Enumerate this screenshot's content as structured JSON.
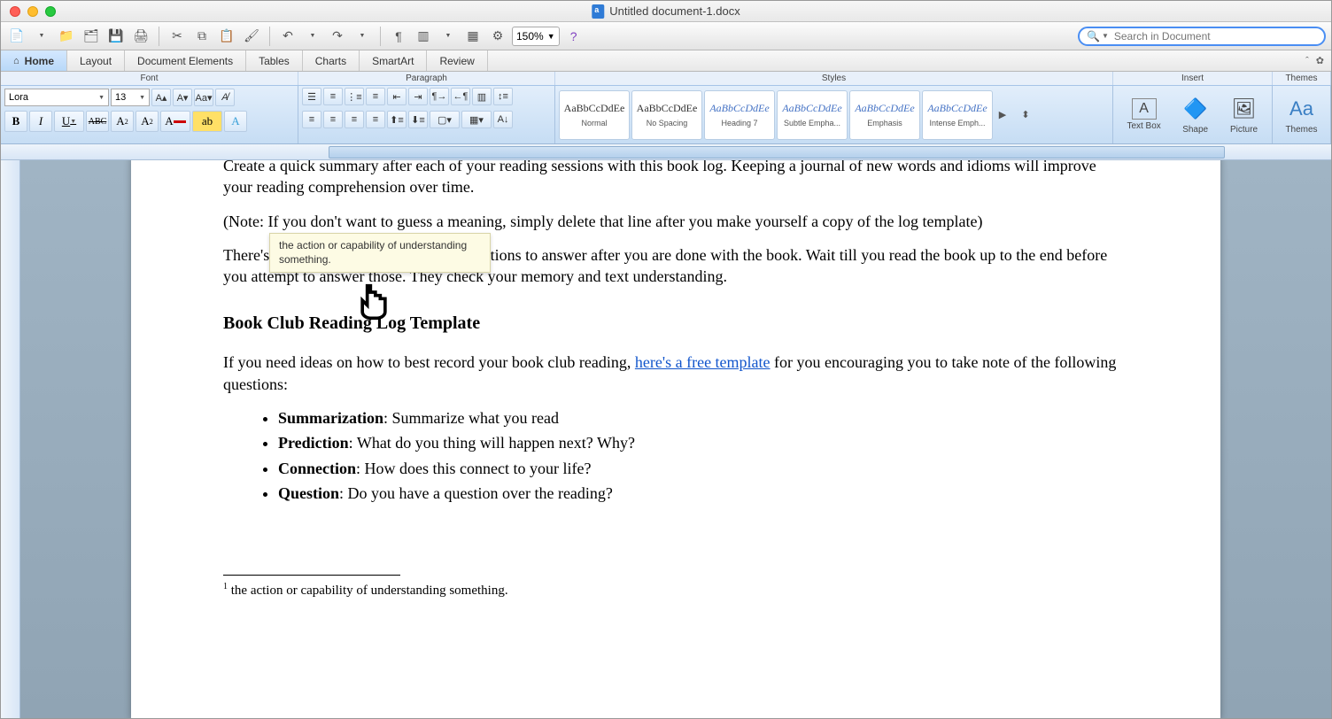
{
  "window": {
    "title": "Untitled document-1.docx"
  },
  "toolbar": {
    "zoom": "150%",
    "search_placeholder": "Search in Document"
  },
  "tabs": {
    "home": "Home",
    "layout": "Layout",
    "docel": "Document Elements",
    "tables": "Tables",
    "charts": "Charts",
    "smartart": "SmartArt",
    "review": "Review"
  },
  "groupLabels": {
    "font": "Font",
    "para": "Paragraph",
    "styles": "Styles",
    "insert": "Insert",
    "themes": "Themes"
  },
  "font": {
    "name": "Lora",
    "size": "13",
    "bold": "B",
    "italic": "I",
    "under": "U",
    "strike": "ABC",
    "sup": "A²",
    "sub": "A₂"
  },
  "styles": {
    "s1": {
      "sample": "AaBbCcDdEe",
      "name": "Normal"
    },
    "s2": {
      "sample": "AaBbCcDdEe",
      "name": "No Spacing"
    },
    "s3": {
      "sample": "AaBbCcDdEe",
      "name": "Heading 7"
    },
    "s4": {
      "sample": "AaBbCcDdEe",
      "name": "Subtle Empha..."
    },
    "s5": {
      "sample": "AaBbCcDdEe",
      "name": "Emphasis"
    },
    "s6": {
      "sample": "AaBbCcDdEe",
      "name": "Intense Emph..."
    }
  },
  "insert": {
    "textbox": "Text Box",
    "shape": "Shape",
    "picture": "Picture",
    "themes": "Themes"
  },
  "doc": {
    "p1": "Create a quick summary after each of your reading sessions with this book log. Keeping a journal of new words and idioms will improve your reading comprehension over time.",
    "p2": "(Note: If you don't want to guess a meaning, simply delete that line after you make yourself a copy of the log template)",
    "p3a": "There's also a list of comprehension",
    "p3b": " questions to answer after you are done with the book. Wait till you read the book up to the end before you attempt to answer those. They check your memory and text understanding.",
    "h1": "Book Club Reading Log Template",
    "p4a": "If you need ideas on how to best record your book club reading, ",
    "p4link": "here's a free template",
    "p4b": " for you encouraging you to take note of the following questions:",
    "li1a": "Summarization",
    "li1b": ": Summarize what you read",
    "li2a": "Prediction",
    "li2b": ": What do you thing will happen next? Why?",
    "li3a": "Connection",
    "li3b": ": How does this connect to your life?",
    "li4a": "Question",
    "li4b": ": Do you have a question over the reading?",
    "fn_ref": "1",
    "fn_text": " the action or capability of understanding something."
  },
  "tooltip": "the action or capability of understanding something."
}
